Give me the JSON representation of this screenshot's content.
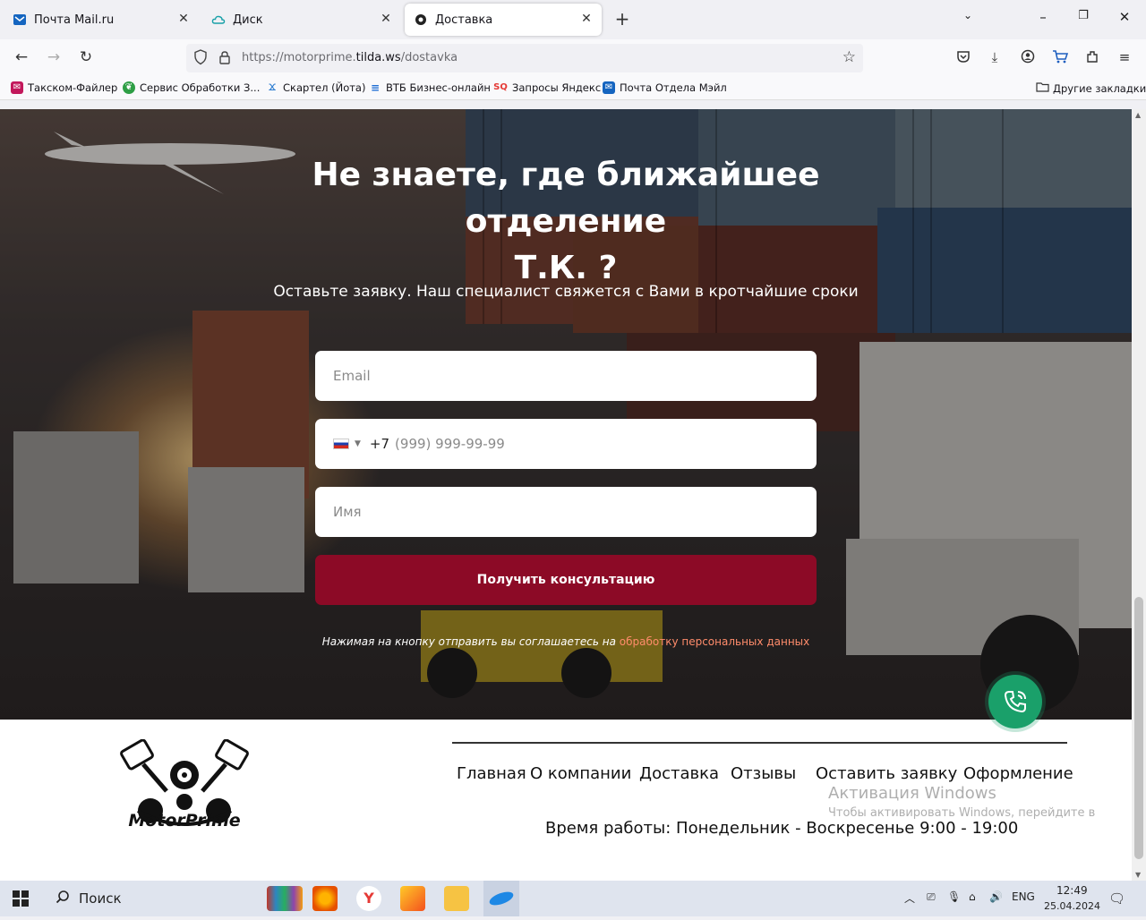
{
  "browser": {
    "tabs": [
      {
        "title": "Почта Mail.ru",
        "icon": "mail-icon"
      },
      {
        "title": "Диск",
        "icon": "cloud-icon"
      },
      {
        "title": "Доставка",
        "icon": "motorprime-favicon",
        "active": true
      }
    ],
    "url_prefix": "https://motorprime.",
    "url_domain": "tilda.ws",
    "url_path": "/dostavka",
    "bookmarks": [
      {
        "label": "Такском-Файлер",
        "icon": "taxcom-icon",
        "color": "#c2185b"
      },
      {
        "label": "Сервис Обработки З...",
        "icon": "leaf-icon",
        "color": "#2e9e45"
      },
      {
        "label": "Скартел (Йота)",
        "icon": "yota-icon",
        "color": "#2e7dd1"
      },
      {
        "label": "ВТБ Бизнес-онлайн",
        "icon": "vtb-icon",
        "color": "#1f6ed4"
      },
      {
        "label": "Запросы Яндекс",
        "icon": "sq-icon",
        "color": "#e53935"
      },
      {
        "label": "Почта Отдела Мэйл",
        "icon": "mail-icon",
        "color": "#1565c0"
      }
    ],
    "other_bookmarks": "Другие закладки"
  },
  "hero": {
    "heading_line1": "Не знаете, где ближайшее отделение",
    "heading_line2": "Т.К. ?",
    "subtitle": "Оставьте заявку. Наш специалист свяжется с Вами в кротчайшие сроки",
    "email_placeholder": "Email",
    "phone_prefix": "+7",
    "phone_placeholder": "(999) 999-99-99",
    "name_placeholder": "Имя",
    "submit_label": "Получить консультацию",
    "agree_text": "Нажимая на кнопку отправить вы соглашаетесь на",
    "agree_link": "обработку персональных данных"
  },
  "footer": {
    "logo_text": "MotorPrime",
    "nav": [
      "Главная",
      "О компании",
      "Доставка",
      "Отзывы",
      "Оставить заявку",
      "Оформление"
    ],
    "hours": "Время работы: Понедельник - Воскресенье 9:00 - 19:00",
    "watermark_title": "Активация Windows",
    "watermark_text": "Чтобы активировать Windows, перейдите в"
  },
  "taskbar": {
    "search_label": "Поиск",
    "lang": "ENG",
    "time": "12:49",
    "date": "25.04.2024"
  },
  "colors": {
    "accent": "#8c0a26",
    "link": "#ff8c6b",
    "call_button": "#1aa06a"
  }
}
